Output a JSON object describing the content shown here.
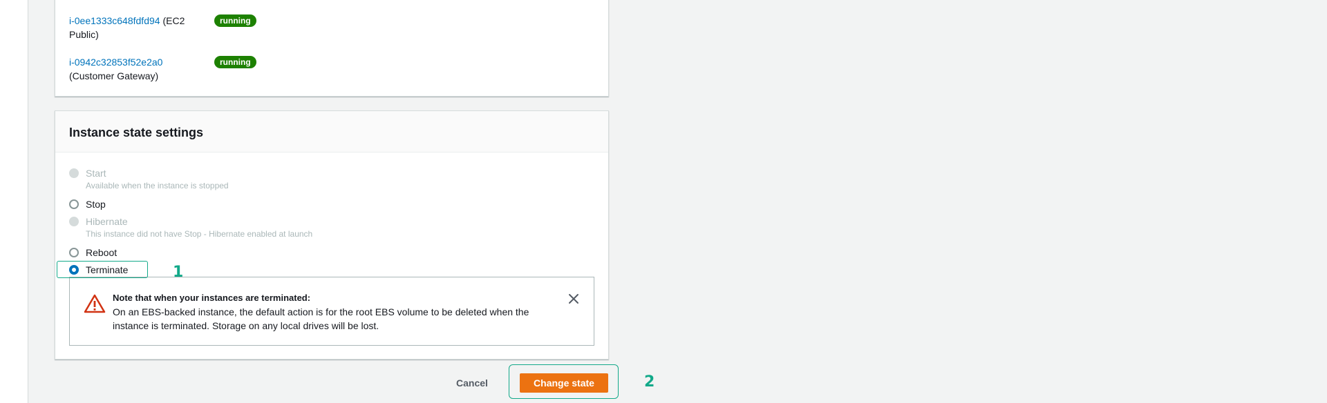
{
  "instances": [
    {
      "id": "i-0ee1333c648fdfd94",
      "name_line1": " (EC2",
      "name_line2": "Public)",
      "status": "running"
    },
    {
      "id": "i-0942c32853f52e2a0",
      "name_line2": "(Customer Gateway)",
      "status": "running"
    }
  ],
  "state_settings": {
    "title": "Instance state settings",
    "options": [
      {
        "label": "Start",
        "description": "Available when the instance is stopped",
        "disabled": true
      },
      {
        "label": "Stop"
      },
      {
        "label": "Hibernate",
        "description": "This instance did not have Stop - Hibernate enabled at launch",
        "disabled": true
      },
      {
        "label": "Reboot"
      },
      {
        "label": "Terminate",
        "selected": true
      }
    ]
  },
  "alert": {
    "title": "Note that when your instances are terminated:",
    "body": "On an EBS-backed instance, the default action is for the root EBS volume to be deleted when the instance is terminated. Storage on any local drives will be lost."
  },
  "footer": {
    "cancel_label": "Cancel",
    "submit_label": "Change state"
  },
  "annotations": {
    "step1": "1",
    "step2": "2"
  },
  "colors": {
    "accent_highlight": "#12a989",
    "primary_button": "#ec7211",
    "link": "#0073bb",
    "running_badge": "#1d8102",
    "warning": "#d13212"
  }
}
